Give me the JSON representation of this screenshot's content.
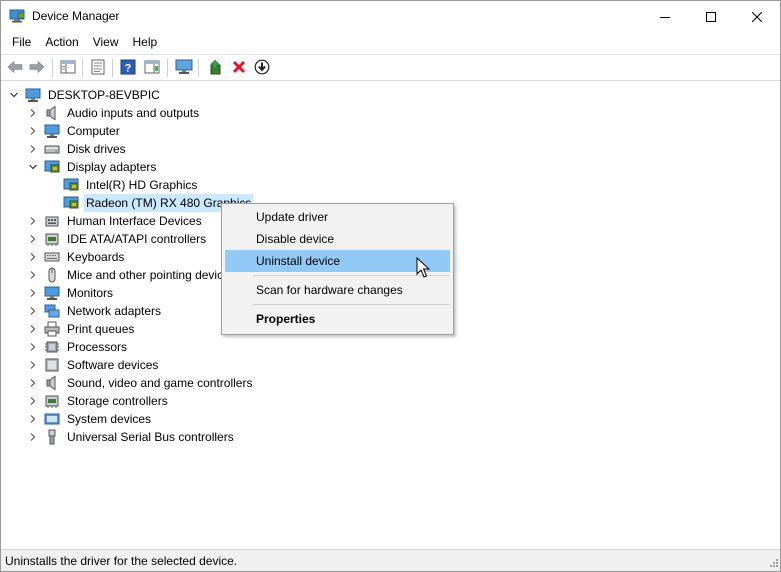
{
  "window": {
    "title": "Device Manager",
    "controls": {
      "minimize": "minimize-icon",
      "maximize": "maximize-icon",
      "close": "close-icon"
    }
  },
  "menu": {
    "file": "File",
    "action": "Action",
    "view": "View",
    "help": "Help"
  },
  "toolbar": {
    "icons": [
      "back-arrow-icon",
      "forward-arrow-icon",
      "show-hide-tree-icon",
      "properties-icon",
      "help-icon",
      "action-pane-icon",
      "scan-hardware-icon",
      "update-driver-icon",
      "uninstall-device-icon",
      "enable-device-icon"
    ]
  },
  "tree": {
    "root": "DESKTOP-8EVBPIC",
    "categories": [
      {
        "label": "Audio inputs and outputs",
        "icon": "speaker-icon"
      },
      {
        "label": "Computer",
        "icon": "computer-icon"
      },
      {
        "label": "Disk drives",
        "icon": "disk-drive-icon"
      },
      {
        "label": "Display adapters",
        "icon": "display-adapter-icon",
        "expanded": true,
        "children": [
          {
            "label": "Intel(R) HD Graphics"
          },
          {
            "label": "Radeon (TM) RX 480 Graphics",
            "selected": true
          }
        ]
      },
      {
        "label": "Human Interface Devices",
        "icon": "hid-icon"
      },
      {
        "label": "IDE ATA/ATAPI controllers",
        "icon": "ide-controller-icon"
      },
      {
        "label": "Keyboards",
        "icon": "keyboard-icon"
      },
      {
        "label": "Mice and other pointing devices",
        "icon": "mouse-icon"
      },
      {
        "label": "Monitors",
        "icon": "monitor-icon"
      },
      {
        "label": "Network adapters",
        "icon": "network-adapter-icon"
      },
      {
        "label": "Print queues",
        "icon": "printer-icon"
      },
      {
        "label": "Processors",
        "icon": "processor-icon"
      },
      {
        "label": "Software devices",
        "icon": "software-device-icon"
      },
      {
        "label": "Sound, video and game controllers",
        "icon": "sound-icon"
      },
      {
        "label": "Storage controllers",
        "icon": "storage-controller-icon"
      },
      {
        "label": "System devices",
        "icon": "system-device-icon"
      },
      {
        "label": "Universal Serial Bus controllers",
        "icon": "usb-icon"
      }
    ]
  },
  "context_menu": {
    "update_driver": "Update driver",
    "disable_device": "Disable device",
    "uninstall_device": "Uninstall device",
    "scan_hardware": "Scan for hardware changes",
    "properties": "Properties"
  },
  "status": {
    "text": "Uninstalls the driver for the selected device."
  },
  "colors": {
    "selection": "#cce8ff",
    "menu_highlight": "#91c9f7",
    "menu_bg": "#f2f2f2",
    "uninstall_red": "#e81123"
  }
}
